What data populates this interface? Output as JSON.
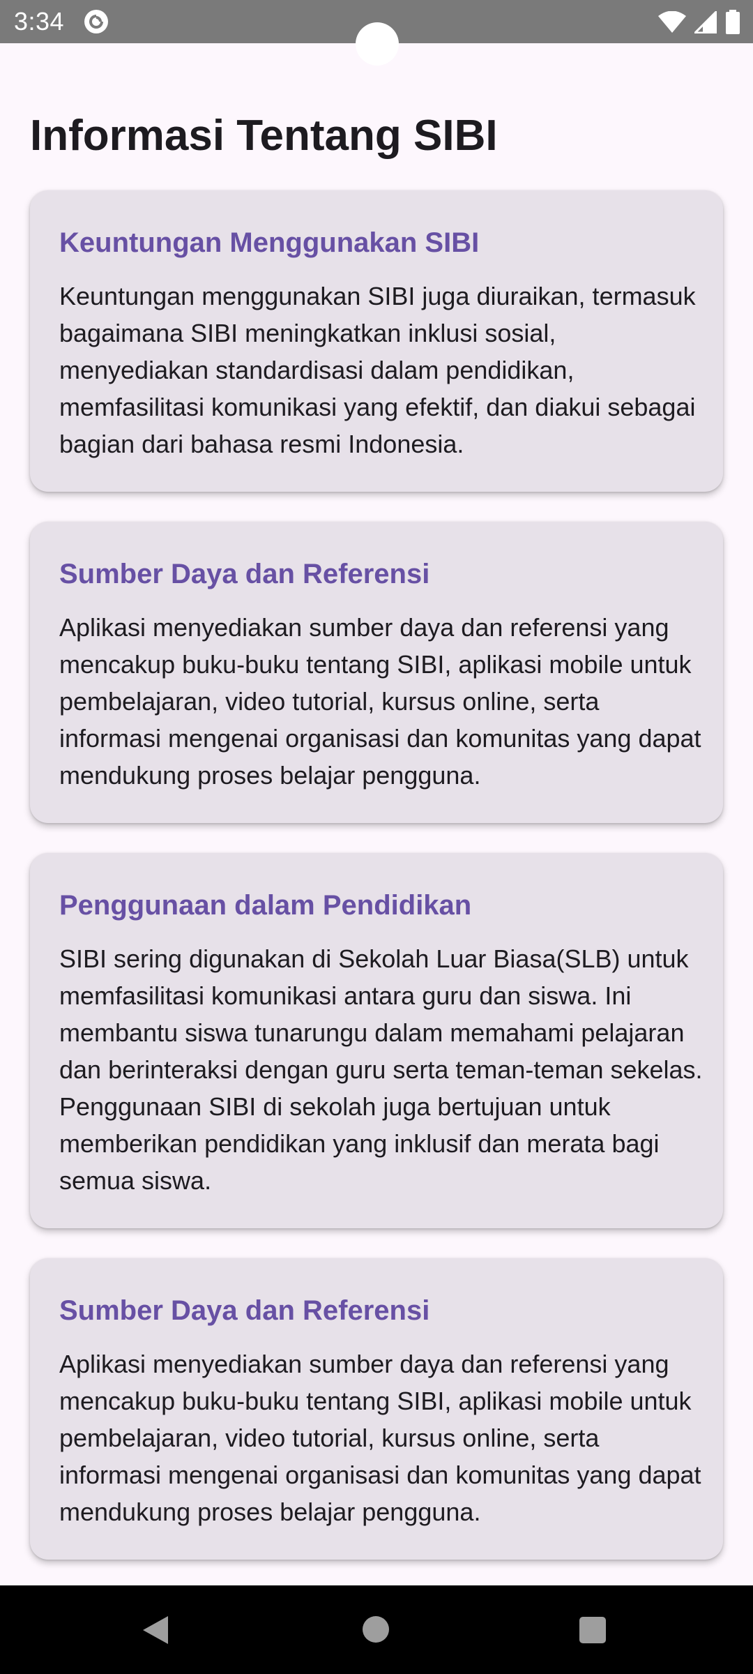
{
  "status_bar": {
    "time": "3:34",
    "app_icon": "pocket-casts-icon",
    "icons": [
      "wifi-icon",
      "signal-icon",
      "battery-icon"
    ]
  },
  "page": {
    "title": "Informasi Tentang SIBI"
  },
  "cards": [
    {
      "title": "Keuntungan Menggunakan SIBI",
      "body": "Keuntungan menggunakan SIBI juga diuraikan, termasuk bagaimana SIBI meningkatkan inklusi sosial, menyediakan standardisasi dalam pendidikan, memfasilitasi komunikasi yang efektif, dan diakui sebagai bagian dari bahasa resmi Indonesia."
    },
    {
      "title": "Sumber Daya dan Referensi",
      "body": "Aplikasi menyediakan sumber daya dan referensi yang mencakup buku-buku tentang SIBI, aplikasi mobile untuk pembelajaran, video tutorial, kursus online, serta informasi mengenai organisasi dan komunitas yang dapat mendukung proses belajar pengguna."
    },
    {
      "title": "Penggunaan dalam Pendidikan",
      "body": "SIBI sering digunakan di Sekolah Luar Biasa(SLB) untuk memfasilitasi komunikasi antara guru dan siswa. Ini membantu siswa tunarungu dalam memahami pelajaran dan berinteraksi dengan guru serta teman-teman sekelas. Penggunaan SIBI di sekolah juga bertujuan untuk memberikan pendidikan yang inklusif dan merata bagi semua siswa."
    },
    {
      "title": "Sumber Daya dan Referensi",
      "body": "Aplikasi menyediakan sumber daya dan referensi yang mencakup buku-buku tentang SIBI, aplikasi mobile untuk pembelajaran, video tutorial, kursus online, serta informasi mengenai organisasi dan komunitas yang dapat mendukung proses belajar pengguna."
    }
  ],
  "nav_bar": {
    "buttons": [
      "back-icon",
      "home-icon",
      "recents-icon"
    ]
  },
  "colors": {
    "background": "#fdf7fd",
    "card": "#e7e1e9",
    "accent": "#6750a4",
    "text": "#1d1b20",
    "status_bar": "#7a7a7a"
  }
}
